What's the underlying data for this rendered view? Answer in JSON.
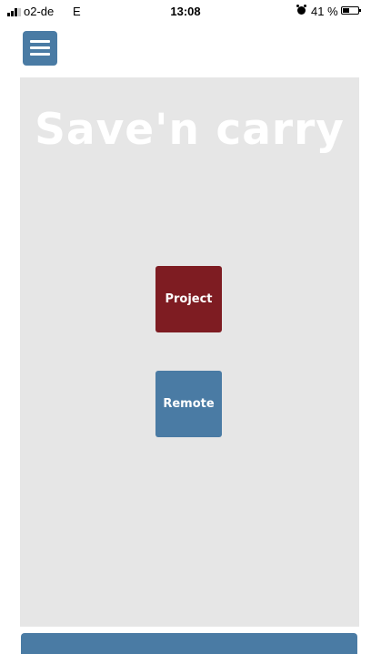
{
  "status_bar": {
    "carrier": "o2-de",
    "network": "E",
    "time": "13:08",
    "battery_percent": "41 %",
    "battery_level": 0.41,
    "signal_bars": 3
  },
  "header": {
    "menu_icon": "hamburger-menu-icon"
  },
  "main": {
    "title": "Save'n carry",
    "buttons": [
      {
        "label": "Project",
        "color": "#7e1c22"
      },
      {
        "label": "Remote",
        "color": "#4a7ba4"
      }
    ]
  },
  "theme": {
    "accent": "#4a7ba4",
    "panel_background": "#e6e6e6"
  }
}
